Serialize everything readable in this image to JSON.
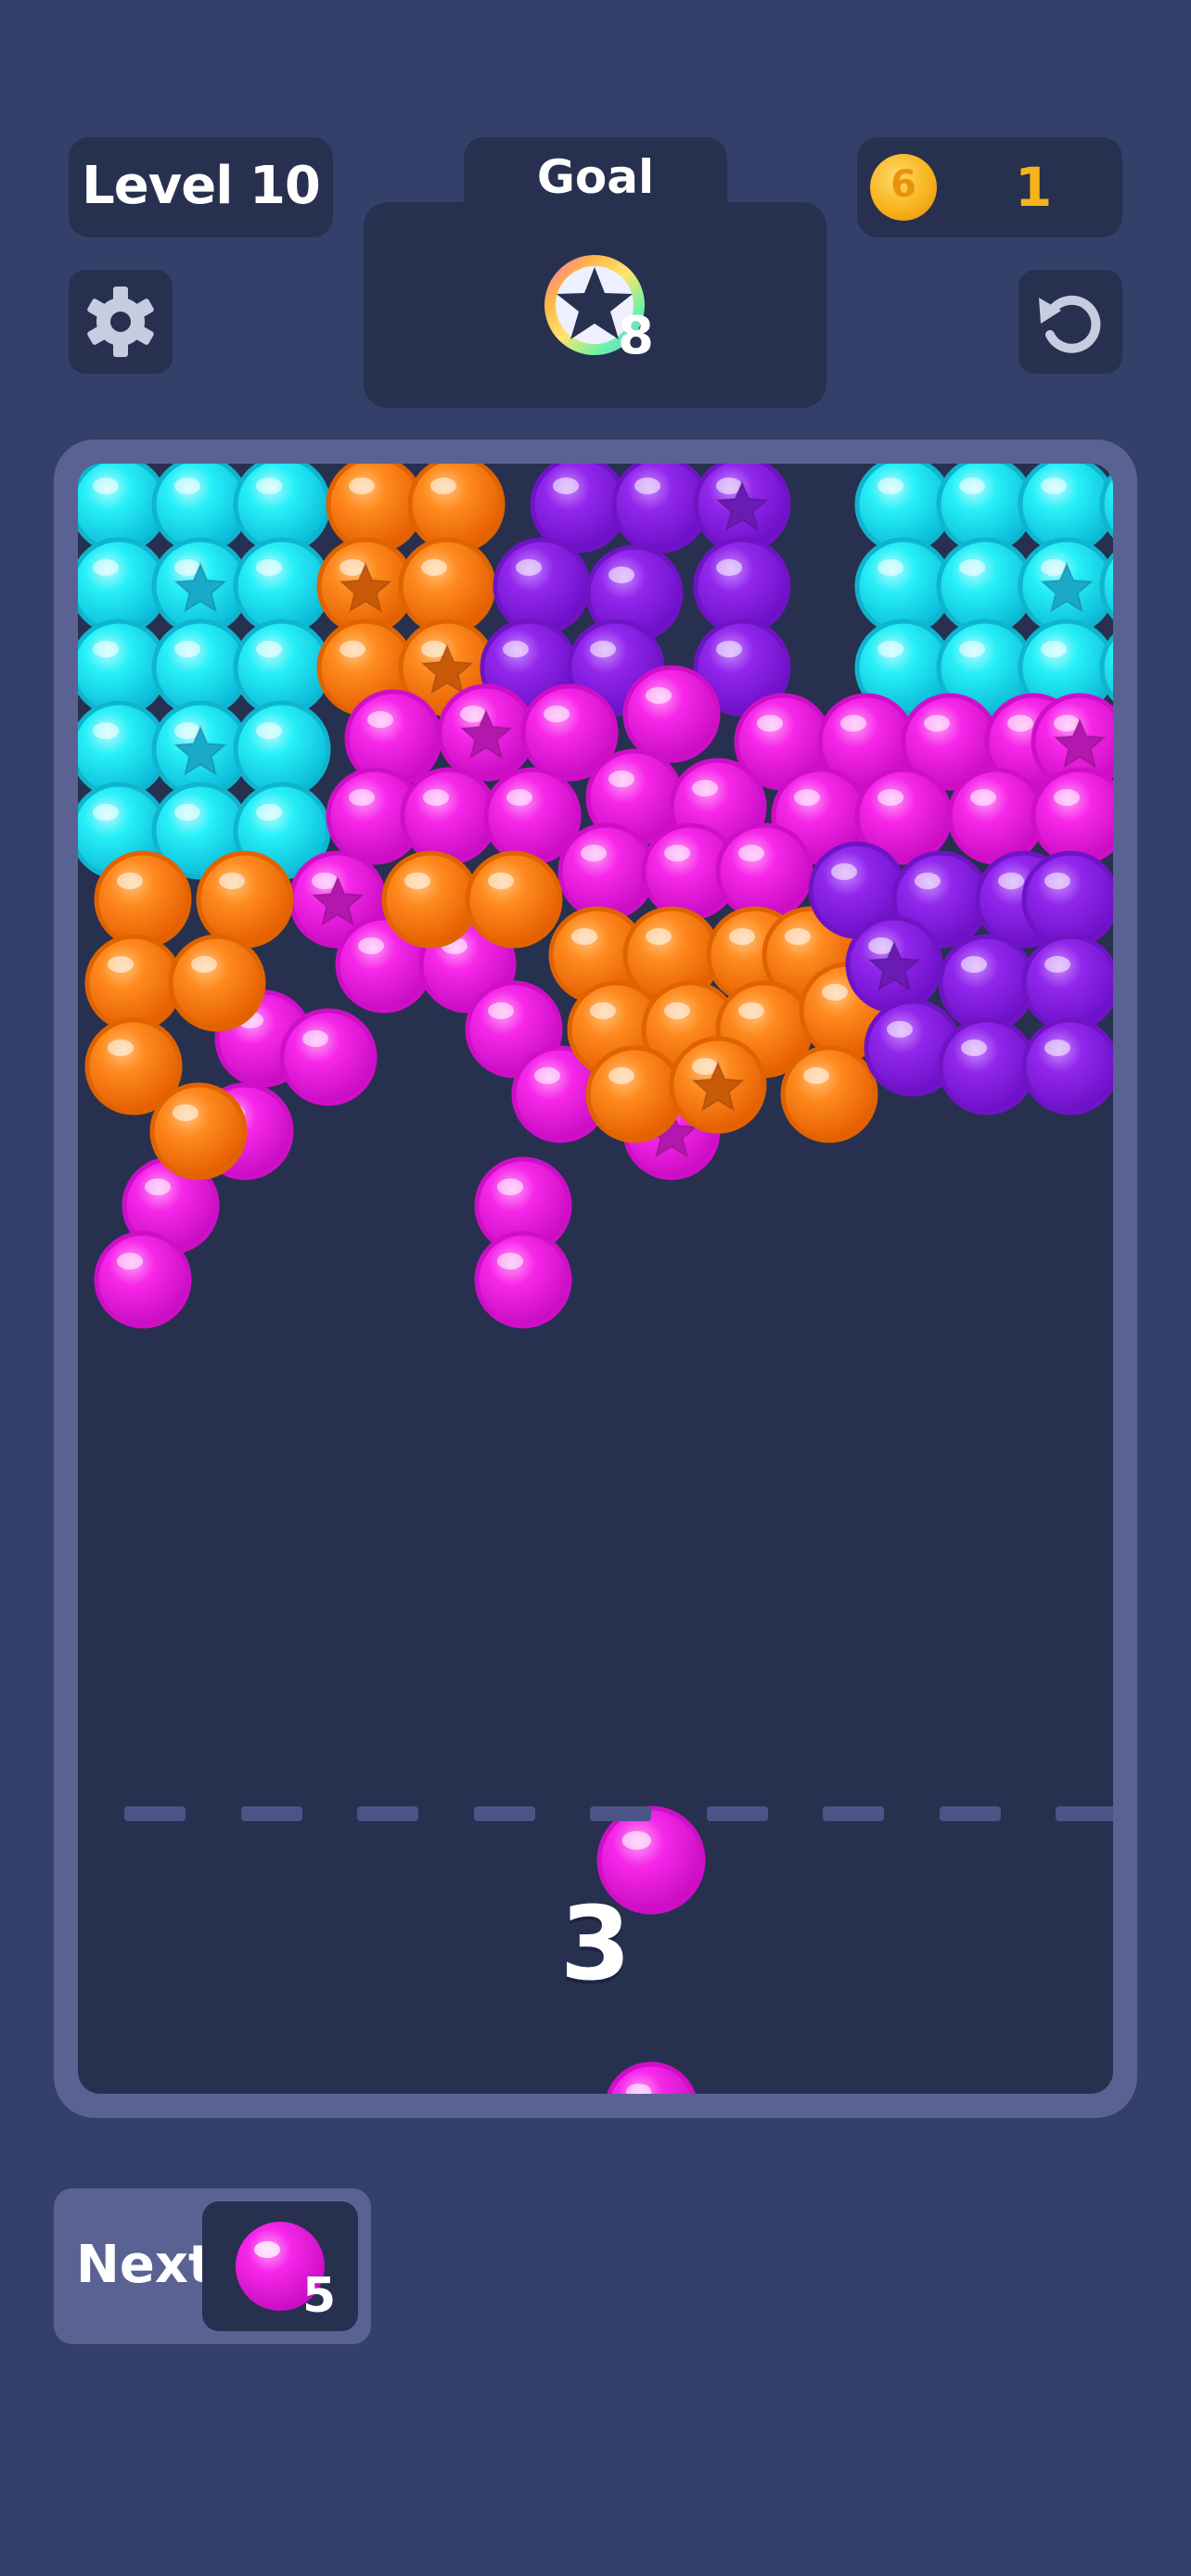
{
  "header": {
    "level_label": "Level 10",
    "goal_label": "Goal",
    "goal_target_icon": "star-bubble-icon",
    "goal_count": "8",
    "coins": "1",
    "coin_icon": "coin-icon"
  },
  "controls": {
    "settings_icon": "gear-icon",
    "undo_icon": "undo-icon"
  },
  "shooter": {
    "shots_left": "3",
    "current_color": "magenta"
  },
  "next": {
    "label": "Next",
    "count": "5",
    "color": "magenta"
  },
  "colors": {
    "background": "#33406a",
    "panel": "#27304f",
    "board_frame": "#5a6294",
    "coin_text": "#f7b318",
    "cyan": "#13e8f2",
    "orange": "#ff7a12",
    "purple": "#8d1ee8",
    "magenta": "#f51ae8"
  }
}
